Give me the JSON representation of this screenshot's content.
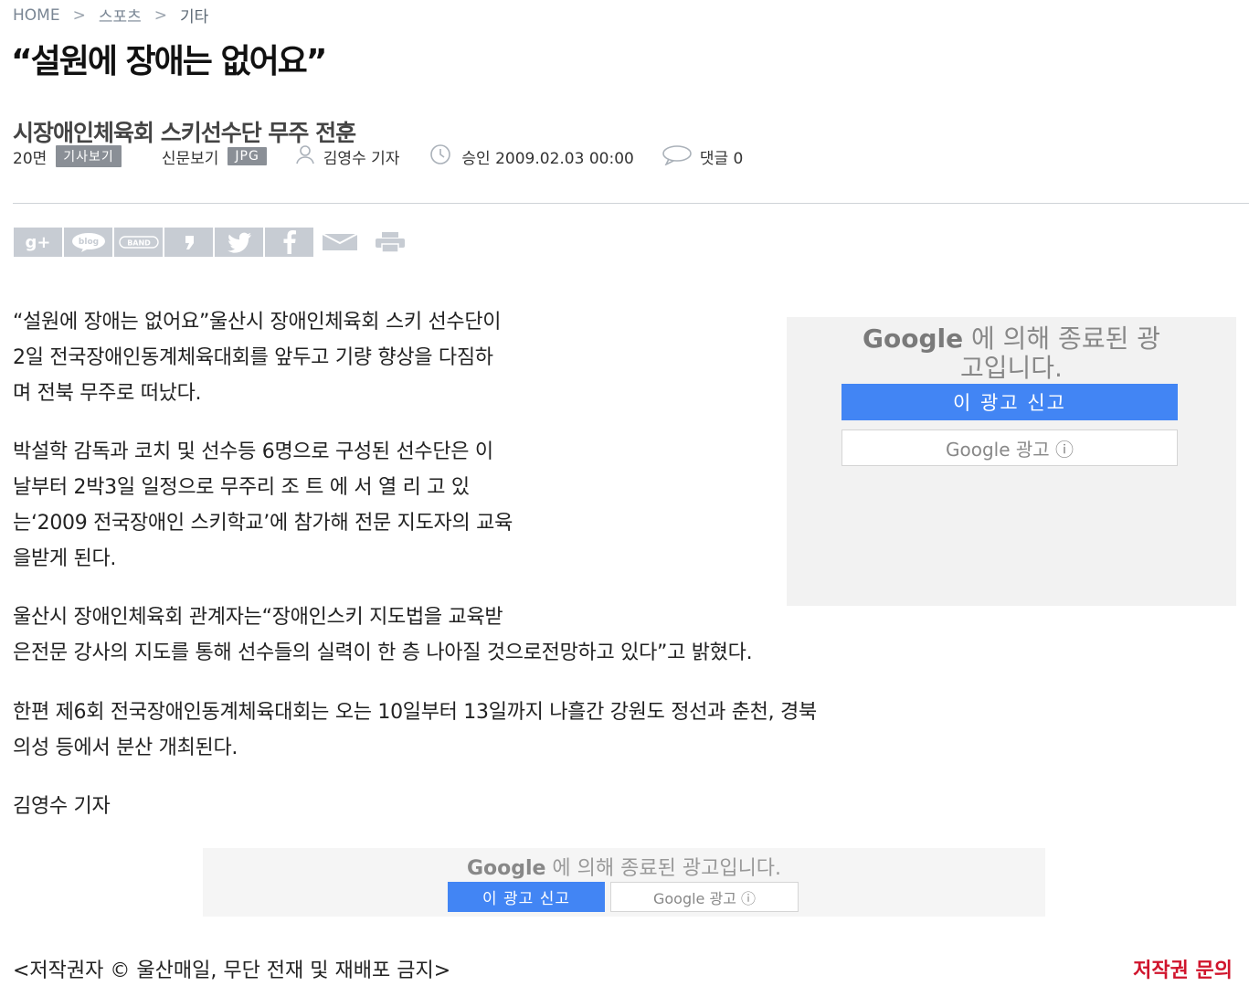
{
  "breadcrumb": {
    "home": "HOME",
    "sep1": ">",
    "section": "스포츠",
    "sep2": ">",
    "current": "기타"
  },
  "article": {
    "title": "“설원에 장애는 없어요”",
    "subtitle": "시장애인체육회 스키선수단 무주 전훈",
    "meta": {
      "page": "20면",
      "view_article": "기사보기",
      "view_paper": "신문보기",
      "format": "JPG",
      "author": "김영수 기자",
      "approved": "승인 2009.02.03 00:00",
      "comments": "댓글 0"
    },
    "paragraphs": [
      {
        "lines": [
          "“설원에 장애는 없어요”울산시 장애인체육회 스키 선수단이",
          "2일 전국장애인동계체육대회를 앞두고 기량 향상을 다짐하",
          "며 전북 무주로 떠났다."
        ]
      },
      {
        "lines": [
          "박설학 감독과 코치 및 선수등 6명으로 구성된 선수단은 이",
          "날부터 2박3일 일정으로 무주리 조 트 에 서 열 리 고 있",
          "는‘2009 전국장애인 스키학교’에 참가해 전문 지도자의 교육",
          "을받게 된다."
        ]
      },
      {
        "lines": [
          "울산시 장애인체육회 관계자는“장애인스키 지도법을 교육받",
          "은전문 강사의 지도를 통해 선수들의 실력이 한 층 나아질 것으로전망하고 있다”고 밝혔다."
        ]
      },
      {
        "lines": [
          "한편 제6회 전국장애인동계체육대회는 오는 10일부터 13일까지 나흘간 강원도 정선과 춘천, 경북",
          "의성 등에서 분산 개최된다."
        ]
      },
      {
        "lines": [
          "김영수 기자"
        ]
      }
    ]
  },
  "share_icons": [
    "google-plus-icon",
    "blog-icon",
    "band-icon",
    "kakao-story-icon",
    "twitter-icon",
    "facebook-icon",
    "mail-icon",
    "print-icon"
  ],
  "ad_side": {
    "google": "Google",
    "line1": " 에 의해 종료된 광",
    "line2": "고입니다.",
    "report": "이 광고 신고",
    "why": "Google 광고 ⓘ"
  },
  "ad_bottom": {
    "google": "Google",
    "text": " 에 의해 종료된 광고입니다.",
    "report": "이 광고 신고",
    "why": "Google 광고 ⓘ"
  },
  "footer": {
    "copyright": "<저작권자 © 울산매일, 무단 전재 및 재배포 금지>",
    "inquiry": "저작권 문의"
  },
  "colors": {
    "accent_blue": "#4285f4",
    "inquiry_red": "#d0142c",
    "badge_gray": "#8a8f96"
  }
}
